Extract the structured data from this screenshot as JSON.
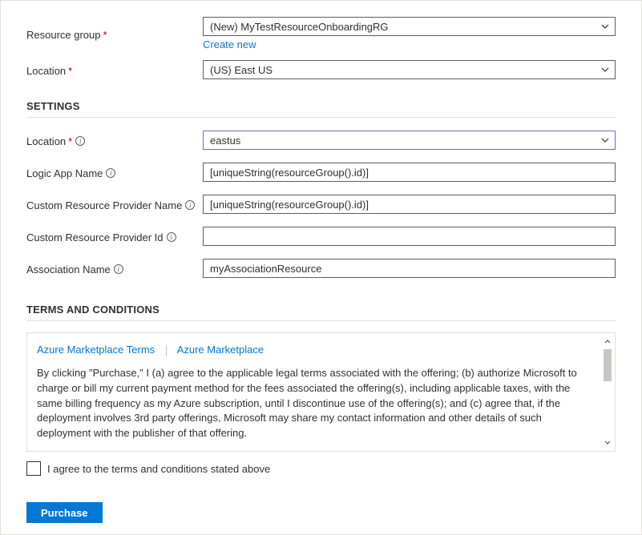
{
  "top": {
    "resource_group_label": "Resource group",
    "resource_group_value": "(New) MyTestResourceOnboardingRG",
    "create_new_link": "Create new",
    "location_label": "Location",
    "location_value": "(US) East US"
  },
  "settings": {
    "heading": "SETTINGS",
    "location_label": "Location",
    "location_value": "eastus",
    "logic_app_label": "Logic App Name",
    "logic_app_value": "[uniqueString(resourceGroup().id)]",
    "crp_name_label": "Custom Resource Provider Name",
    "crp_name_value": "[uniqueString(resourceGroup().id)]",
    "crp_id_label": "Custom Resource Provider Id",
    "crp_id_value": "",
    "assoc_label": "Association Name",
    "assoc_value": "myAssociationResource"
  },
  "terms": {
    "heading": "TERMS AND CONDITIONS",
    "link1": "Azure Marketplace Terms",
    "link2": "Azure Marketplace",
    "body": "By clicking \"Purchase,\" I (a) agree to the applicable legal terms associated with the offering; (b) authorize Microsoft to charge or bill my current payment method for the fees associated the offering(s), including applicable taxes, with the same billing frequency as my Azure subscription, until I discontinue use of the offering(s); and (c) agree that, if the deployment involves 3rd party offerings, Microsoft may share my contact information and other details of such deployment with the publisher of that offering.",
    "agree_label": "I agree to the terms and conditions stated above"
  },
  "purchase_label": "Purchase"
}
